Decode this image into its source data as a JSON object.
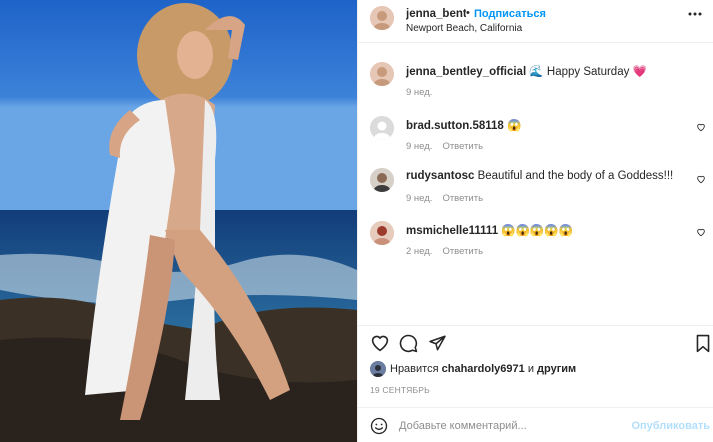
{
  "photo": {
    "description_icon": "photo"
  },
  "header": {
    "username": "jenna_bentley_official",
    "dot": "•",
    "follow_label": "Подписаться",
    "location": "Newport Beach, California"
  },
  "caption": {
    "username": "jenna_bentley_official",
    "wave": "🌊",
    "text": " Happy Saturday ",
    "heart": "💗",
    "time": "9 нед."
  },
  "comments": [
    {
      "username": "brad.sutton.58118",
      "text": " 😱",
      "time": "9 нед.",
      "reply": "Ответить"
    },
    {
      "username": "rudysantosc",
      "text": " Beautiful and the body of a Goddess!!!",
      "time": "9 нед.",
      "reply": "Ответить"
    },
    {
      "username": "msmichelle11111",
      "text": " 😱😱😱😱😱",
      "time": "2 нед.",
      "reply": "Ответить"
    }
  ],
  "likes": {
    "prefix": "Нравится ",
    "user": "chahardoly6971",
    "suffix": " и ",
    "others": "другим"
  },
  "date": "19 СЕНТЯБРЬ",
  "add_comment": {
    "placeholder": "Добавьте комментарий...",
    "publish_label": "Опубликовать"
  },
  "colors": {
    "link": "#0095f6",
    "publish_disabled": "#b2dffc",
    "muted": "#8e8e8e"
  }
}
